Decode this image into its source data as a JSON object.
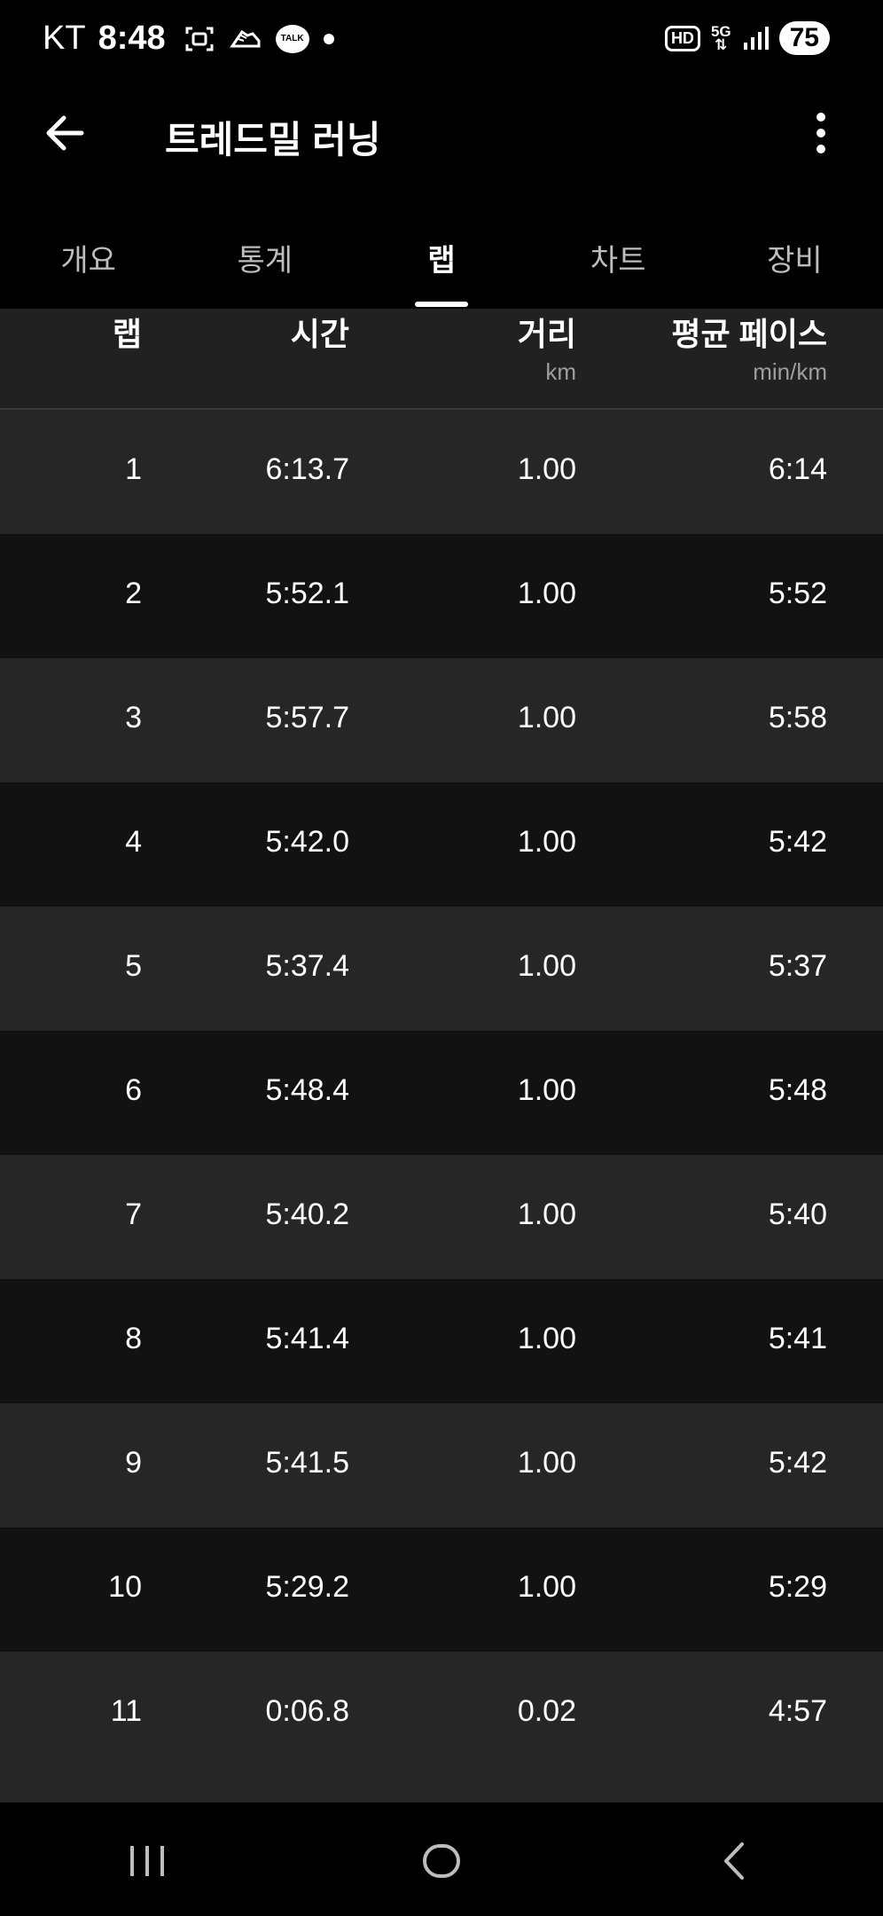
{
  "status_bar": {
    "carrier": "KT",
    "time": "8:48",
    "talk_badge": "TALK",
    "hd": "HD",
    "network": "5G",
    "battery": "75"
  },
  "app_bar": {
    "title": "트레드밀 러닝"
  },
  "tabs": [
    {
      "label": "개요",
      "active": false
    },
    {
      "label": "통계",
      "active": false
    },
    {
      "label": "랩",
      "active": true
    },
    {
      "label": "차트",
      "active": false
    },
    {
      "label": "장비",
      "active": false
    }
  ],
  "table": {
    "headers": {
      "lap": "랩",
      "time": "시간",
      "distance": "거리",
      "distance_unit": "km",
      "pace": "평균 페이스",
      "pace_unit": "min/km"
    },
    "rows": [
      {
        "lap": "1",
        "time": "6:13.7",
        "distance": "1.00",
        "pace": "6:14"
      },
      {
        "lap": "2",
        "time": "5:52.1",
        "distance": "1.00",
        "pace": "5:52"
      },
      {
        "lap": "3",
        "time": "5:57.7",
        "distance": "1.00",
        "pace": "5:58"
      },
      {
        "lap": "4",
        "time": "5:42.0",
        "distance": "1.00",
        "pace": "5:42"
      },
      {
        "lap": "5",
        "time": "5:37.4",
        "distance": "1.00",
        "pace": "5:37"
      },
      {
        "lap": "6",
        "time": "5:48.4",
        "distance": "1.00",
        "pace": "5:48"
      },
      {
        "lap": "7",
        "time": "5:40.2",
        "distance": "1.00",
        "pace": "5:40"
      },
      {
        "lap": "8",
        "time": "5:41.4",
        "distance": "1.00",
        "pace": "5:41"
      },
      {
        "lap": "9",
        "time": "5:41.5",
        "distance": "1.00",
        "pace": "5:42"
      },
      {
        "lap": "10",
        "time": "5:29.2",
        "distance": "1.00",
        "pace": "5:29"
      },
      {
        "lap": "11",
        "time": "0:06.8",
        "distance": "0.02",
        "pace": "4:57"
      }
    ]
  },
  "colors": {
    "background": "#000000",
    "row_odd": "#262626",
    "row_even": "#121212",
    "muted_text": "#9e9e9e"
  },
  "icons": {
    "back": "arrow-left-icon",
    "more": "more-vertical-icon",
    "nav_recent": "recent-apps-icon",
    "nav_home": "home-icon",
    "nav_back": "chevron-left-icon"
  }
}
